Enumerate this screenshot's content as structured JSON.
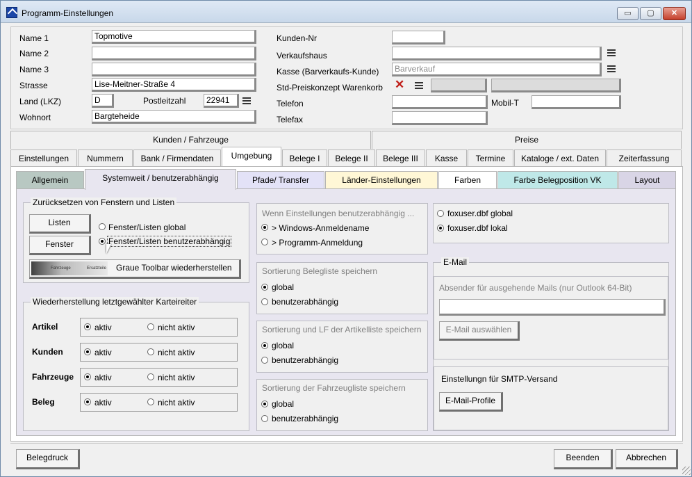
{
  "window": {
    "title": "Programm-Einstellungen",
    "min": "▭",
    "max": "▢",
    "close": "✕"
  },
  "fields": {
    "name1": {
      "label": "Name 1",
      "value": "Topmotive"
    },
    "name2": {
      "label": "Name 2",
      "value": ""
    },
    "name3": {
      "label": "Name 3",
      "value": ""
    },
    "strasse": {
      "label": "Strasse",
      "value": "Lise-Meitner-Straße 4"
    },
    "land": {
      "label": "Land (LKZ)",
      "value": "D"
    },
    "plz": {
      "label": "Postleitzahl",
      "value": "22941"
    },
    "wohnort": {
      "label": "Wohnort",
      "value": "Bargteheide"
    },
    "kundennr": {
      "label": "Kunden-Nr",
      "value": ""
    },
    "verkaufshaus": {
      "label": "Verkaufshaus",
      "value": ""
    },
    "kasse": {
      "label": "Kasse (Barverkaufs-Kunde)",
      "placeholder": "Barverkauf"
    },
    "preiskonzept": {
      "label": "Std-Preiskonzept Warenkorb",
      "value": ""
    },
    "telefon": {
      "label": "Telefon",
      "value": ""
    },
    "mobil": {
      "label": "Mobil-T",
      "value": ""
    },
    "telefax": {
      "label": "Telefax",
      "value": ""
    }
  },
  "group_tabs": [
    "Kunden / Fahrzeuge",
    "Preise"
  ],
  "tabs": [
    "Einstellungen",
    "Nummern",
    "Bank / Firmendaten",
    "Umgebung",
    "Belege I",
    "Belege II",
    "Belege III",
    "Kasse",
    "Termine",
    "Kataloge / ext. Daten",
    "Zeiterfassung"
  ],
  "subtabs": [
    "Allgemein",
    "Systemweit / benutzerabhängig",
    "Pfade/ Transfer",
    "Länder-Einstellungen",
    "Farben",
    "Farbe Belegposition VK",
    "Layout"
  ],
  "colors": {
    "allgemein": "#b8c8c2",
    "pfade": "#e3e2f7",
    "laender": "#fff7d6",
    "farbe_beleg": "#bfe8e8",
    "layout": "#d9d5e6",
    "panel": "#e8e6f0"
  },
  "reset": {
    "title": "Zurücksetzen von Fenstern und Listen",
    "btn_listen": "Listen",
    "btn_fenster": "Fenster",
    "opt_global": "Fenster/Listen global",
    "opt_user": "Fenster/Listen benutzerabhängig",
    "toolbar_small1": "Fahrzeuge",
    "toolbar_small2": "Ersatzteile",
    "btn_toolbar": "Graue Toolbar wiederherstellen"
  },
  "restore": {
    "title": "Wiederherstellung letztgewählter Karteireiter",
    "rows": [
      {
        "label": "Artikel",
        "on": "aktiv",
        "off": "nicht aktiv"
      },
      {
        "label": "Kunden",
        "on": "aktiv",
        "off": "nicht aktiv"
      },
      {
        "label": "Fahrzeuge",
        "on": "aktiv",
        "off": "nicht aktiv"
      },
      {
        "label": "Beleg",
        "on": "aktiv",
        "off": "nicht aktiv"
      }
    ]
  },
  "mid": [
    {
      "title": "Wenn Einstellungen benutzerabhängig ...",
      "a": "> Windows-Anmeldename",
      "b": "> Programm-Anmeldung"
    },
    {
      "title": "Sortierung Belegliste speichern",
      "a": "global",
      "b": "benutzerabhängig"
    },
    {
      "title": "Sortierung und LF der Artikelliste speichern",
      "a": "global",
      "b": "benutzerabhängig"
    },
    {
      "title": "Sortierung der Fahrzeugliste speichern",
      "a": "global",
      "b": "benutzerabhängig"
    }
  ],
  "foxuser": {
    "global": "foxuser.dbf global",
    "lokal": "foxuser.dbf lokal"
  },
  "email": {
    "title": "E-Mail",
    "absender": "Absender für ausgehende Mails (nur Outlook 64-Bit)",
    "btn_select": "E-Mail auswählen",
    "smtp": "Einstellungn für SMTP-Versand",
    "btn_profile": "E-Mail-Profile"
  },
  "footer": {
    "belegdruck": "Belegdruck",
    "beenden": "Beenden",
    "abbrechen": "Abbrechen"
  }
}
